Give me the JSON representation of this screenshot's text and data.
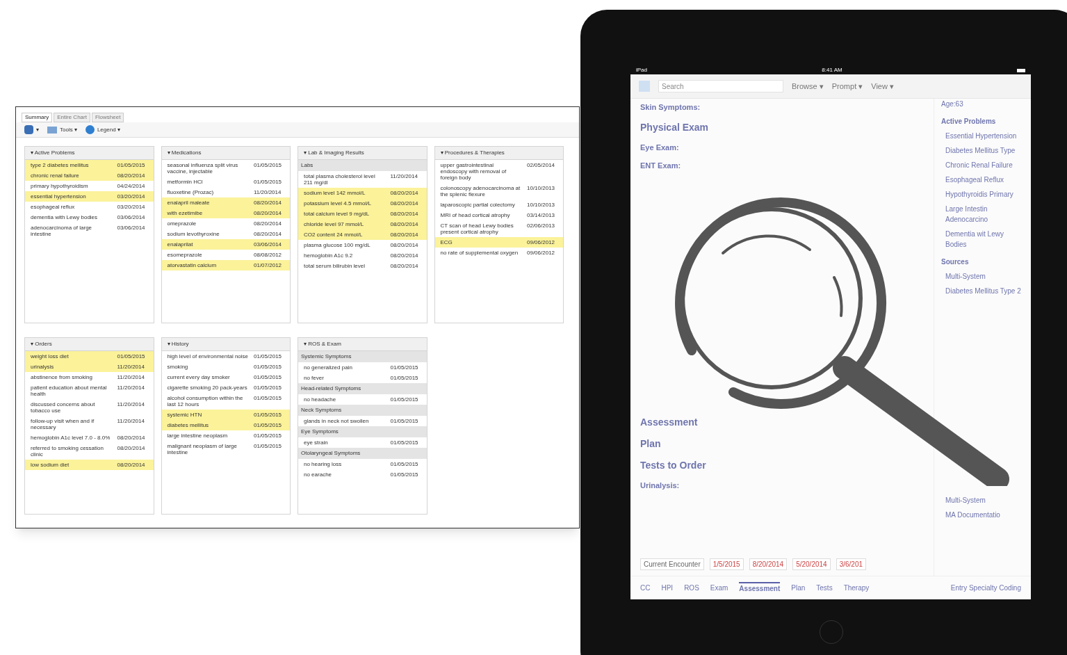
{
  "chart_window": {
    "tabs": [
      {
        "label": "Summary",
        "selected": true
      },
      {
        "label": "Entire Chart",
        "selected": false
      },
      {
        "label": "Flowsheet",
        "selected": false
      }
    ],
    "toolbar": [
      {
        "kind": "layout",
        "label": "▾"
      },
      {
        "kind": "tools",
        "label": "Tools ▾"
      },
      {
        "kind": "legend",
        "label": "Legend ▾"
      }
    ],
    "panels": [
      {
        "title": "▾ Active Problems",
        "rows": [
          {
            "kind": "item",
            "text": "type 2 diabetes mellitus",
            "date": "01/05/2015",
            "highlighted": true
          },
          {
            "kind": "item",
            "text": "chronic renal failure",
            "date": "08/20/2014",
            "highlighted": true
          },
          {
            "kind": "item",
            "text": "primary hypothyroidism",
            "date": "04/24/2014",
            "highlighted": false
          },
          {
            "kind": "item",
            "text": "essential hypertension",
            "date": "03/20/2014",
            "highlighted": true
          },
          {
            "kind": "item",
            "text": "esophageal reflux",
            "date": "03/20/2014",
            "highlighted": false
          },
          {
            "kind": "item",
            "text": "dementia with Lewy bodies",
            "date": "03/06/2014",
            "highlighted": false
          },
          {
            "kind": "item",
            "text": "adenocarcinoma of large intestine",
            "date": "03/06/2014",
            "highlighted": false
          }
        ]
      },
      {
        "title": "▾ Medications",
        "rows": [
          {
            "kind": "item",
            "text": "seasonal influenza split virus vaccine, injectable",
            "date": "01/05/2015",
            "highlighted": false
          },
          {
            "kind": "item",
            "text": "metformin HCl",
            "date": "01/05/2015",
            "highlighted": false
          },
          {
            "kind": "item",
            "text": "fluoxetine (Prozac)",
            "date": "11/20/2014",
            "highlighted": false
          },
          {
            "kind": "item",
            "text": "enalapril maleate",
            "date": "08/20/2014",
            "highlighted": true
          },
          {
            "kind": "item",
            "text": "with ezetimibe",
            "date": "08/20/2014",
            "highlighted": true
          },
          {
            "kind": "item",
            "text": "omeprazole",
            "date": "08/20/2014",
            "highlighted": false
          },
          {
            "kind": "item",
            "text": "sodium levothyroxine",
            "date": "08/20/2014",
            "highlighted": false
          },
          {
            "kind": "item",
            "text": "enalaprilat",
            "date": "03/06/2014",
            "highlighted": true
          },
          {
            "kind": "item",
            "text": "esomeprazole",
            "date": "08/08/2012",
            "highlighted": false
          },
          {
            "kind": "item",
            "text": "atorvastatin calcium",
            "date": "01/07/2012",
            "highlighted": true
          }
        ]
      },
      {
        "title": "▾ Lab & Imaging Results",
        "rows": [
          {
            "kind": "group",
            "text": "Labs"
          },
          {
            "kind": "item",
            "text": "total plasma cholesterol level 211 mg/dl",
            "date": "11/20/2014",
            "highlighted": false
          },
          {
            "kind": "item",
            "text": "sodium level 142 mmol/L",
            "date": "08/20/2014",
            "highlighted": true
          },
          {
            "kind": "item",
            "text": "potassium level 4.5 mmol/L",
            "date": "08/20/2014",
            "highlighted": true
          },
          {
            "kind": "item",
            "text": "total calcium level 9 mg/dL",
            "date": "08/20/2014",
            "highlighted": true
          },
          {
            "kind": "item",
            "text": "chloride level 97 mmol/L",
            "date": "08/20/2014",
            "highlighted": true
          },
          {
            "kind": "item",
            "text": "CO2 content 24 mmol/L",
            "date": "08/20/2014",
            "highlighted": true
          },
          {
            "kind": "item",
            "text": "plasma glucose 100 mg/dL",
            "date": "08/20/2014",
            "highlighted": false
          },
          {
            "kind": "item",
            "text": "hemoglobin A1c 9.2",
            "date": "08/20/2014",
            "highlighted": false
          },
          {
            "kind": "item",
            "text": "total serum bilirubin level",
            "date": "08/20/2014",
            "highlighted": false
          }
        ]
      },
      {
        "title": "▾ Procedures & Therapies",
        "rows": [
          {
            "kind": "item",
            "text": "upper gastrointestinal endoscopy with removal of foreign body",
            "date": "02/05/2014",
            "highlighted": false
          },
          {
            "kind": "item",
            "text": "colonoscopy adenocarcinoma at the splenic flexure",
            "date": "10/10/2013",
            "highlighted": false
          },
          {
            "kind": "item",
            "text": "laparoscopic partial colectomy",
            "date": "10/10/2013",
            "highlighted": false
          },
          {
            "kind": "item",
            "text": "MRI of head cortical atrophy",
            "date": "03/14/2013",
            "highlighted": false
          },
          {
            "kind": "item",
            "text": "CT scan of head Lewy bodies present cortical atrophy",
            "date": "02/06/2013",
            "highlighted": false
          },
          {
            "kind": "item",
            "text": "ECG",
            "date": "09/06/2012",
            "highlighted": true
          },
          {
            "kind": "item",
            "text": "no rate of supplemental oxygen",
            "date": "09/06/2012",
            "highlighted": false
          }
        ]
      },
      {
        "title": "▾ Orders",
        "rows": [
          {
            "kind": "item",
            "text": "weight loss diet",
            "date": "01/05/2015",
            "highlighted": true
          },
          {
            "kind": "item",
            "text": "urinalysis",
            "date": "11/20/2014",
            "highlighted": true
          },
          {
            "kind": "item",
            "text": "abstinence from smoking",
            "date": "11/20/2014",
            "highlighted": false
          },
          {
            "kind": "item",
            "text": "patient education about mental health",
            "date": "11/20/2014",
            "highlighted": false
          },
          {
            "kind": "item",
            "text": "discussed concerns about tobacco use",
            "date": "11/20/2014",
            "highlighted": false
          },
          {
            "kind": "item",
            "text": "follow-up visit when and if necessary",
            "date": "11/20/2014",
            "highlighted": false
          },
          {
            "kind": "item",
            "text": "hemoglobin A1c level 7.0 - 8.0%",
            "date": "08/20/2014",
            "highlighted": false
          },
          {
            "kind": "item",
            "text": "referred to smoking cessation clinic",
            "date": "08/20/2014",
            "highlighted": false
          },
          {
            "kind": "item",
            "text": "low sodium diet",
            "date": "08/20/2014",
            "highlighted": true
          }
        ]
      },
      {
        "title": "▾ History",
        "rows": [
          {
            "kind": "item",
            "text": "high level of environmental noise",
            "date": "01/05/2015",
            "highlighted": false
          },
          {
            "kind": "item",
            "text": "smoking",
            "date": "01/05/2015",
            "highlighted": false
          },
          {
            "kind": "item",
            "text": "current every day smoker",
            "date": "01/05/2015",
            "highlighted": false
          },
          {
            "kind": "item",
            "text": "cigarette smoking 20 pack-years",
            "date": "01/05/2015",
            "highlighted": false
          },
          {
            "kind": "item",
            "text": "alcohol consumption within the last 12 hours",
            "date": "01/05/2015",
            "highlighted": false
          },
          {
            "kind": "item",
            "text": "systemic HTN",
            "date": "01/05/2015",
            "highlighted": true
          },
          {
            "kind": "item",
            "text": "diabetes mellitus",
            "date": "01/05/2015",
            "highlighted": true
          },
          {
            "kind": "item",
            "text": "large intestine neoplasm",
            "date": "01/05/2015",
            "highlighted": false
          },
          {
            "kind": "item",
            "text": "malignant neoplasm of large intestine",
            "date": "01/05/2015",
            "highlighted": false
          }
        ]
      },
      {
        "title": "▾ ROS & Exam",
        "rows": [
          {
            "kind": "group",
            "text": "Systemic Symptoms"
          },
          {
            "kind": "item",
            "text": "no generalized pain",
            "date": "01/05/2015",
            "highlighted": false
          },
          {
            "kind": "item",
            "text": "no fever",
            "date": "01/05/2015",
            "highlighted": false
          },
          {
            "kind": "group",
            "text": "Head-related Symptoms"
          },
          {
            "kind": "item",
            "text": "no headache",
            "date": "01/05/2015",
            "highlighted": false
          },
          {
            "kind": "group",
            "text": "Neck Symptoms"
          },
          {
            "kind": "item",
            "text": "glands in neck not swollen",
            "date": "01/05/2015",
            "highlighted": false
          },
          {
            "kind": "group",
            "text": "Eye Symptoms"
          },
          {
            "kind": "item",
            "text": "eye strain",
            "date": "01/05/2015",
            "highlighted": false
          },
          {
            "kind": "group",
            "text": "Otolaryngeal Symptoms"
          },
          {
            "kind": "item",
            "text": "no hearing loss",
            "date": "01/05/2015",
            "highlighted": false
          },
          {
            "kind": "item",
            "text": "no earache",
            "date": "01/05/2015",
            "highlighted": false
          }
        ]
      }
    ]
  },
  "tablet": {
    "status_bar": {
      "device": "iPad",
      "time": "8:41 AM"
    },
    "toolbar": {
      "search_placeholder": "Search",
      "buttons": [
        "Browse ▾",
        "Prompt ▾",
        "View ▾"
      ]
    },
    "note": [
      {
        "kind": "line",
        "label": "Skin Symptoms:"
      },
      {
        "kind": "heading",
        "label": "Physical Exam"
      },
      {
        "kind": "line",
        "label": "Eye Exam:"
      },
      {
        "kind": "line",
        "label": "ENT Exam:"
      },
      {
        "kind": "spacer"
      },
      {
        "kind": "heading",
        "label": "Assessment"
      },
      {
        "kind": "heading",
        "label": "Plan"
      },
      {
        "kind": "heading",
        "label": "Tests to Order"
      },
      {
        "kind": "line",
        "label": "Urinalysis:"
      }
    ],
    "sidebar": {
      "patient": "Age:63",
      "sections": [
        {
          "title": "Active Problems",
          "items": [
            "Essential Hypertension",
            "Diabetes Mellitus Type",
            "Chronic Renal Failure",
            "Esophageal Reflux",
            "Hypothyroidis Primary",
            "Large Intestin Adenocarcino",
            "Dementia wit Lewy Bodies"
          ]
        },
        {
          "title": "Sources",
          "items": [
            "Multi-System",
            "Diabetes Mellitus Type 2"
          ]
        },
        {
          "items": [
            "Multi-System",
            "MA Documentatio"
          ]
        }
      ]
    },
    "encounters": [
      {
        "label": "Current Encounter",
        "selected": true
      },
      {
        "label": "1/5/2015",
        "selected": false
      },
      {
        "label": "8/20/2014",
        "selected": false
      },
      {
        "label": "5/20/2014",
        "selected": false
      },
      {
        "label": "3/6/201",
        "selected": false
      }
    ],
    "bottom_tabs": [
      {
        "label": "CC",
        "selected": false
      },
      {
        "label": "HPI",
        "selected": false
      },
      {
        "label": "ROS",
        "selected": false
      },
      {
        "label": "Exam",
        "selected": false
      },
      {
        "label": "Assessment",
        "selected": true
      },
      {
        "label": "Plan",
        "selected": false
      },
      {
        "label": "Tests",
        "selected": false
      },
      {
        "label": "Therapy",
        "selected": false
      }
    ],
    "coding": "Entry Specialty Coding"
  }
}
